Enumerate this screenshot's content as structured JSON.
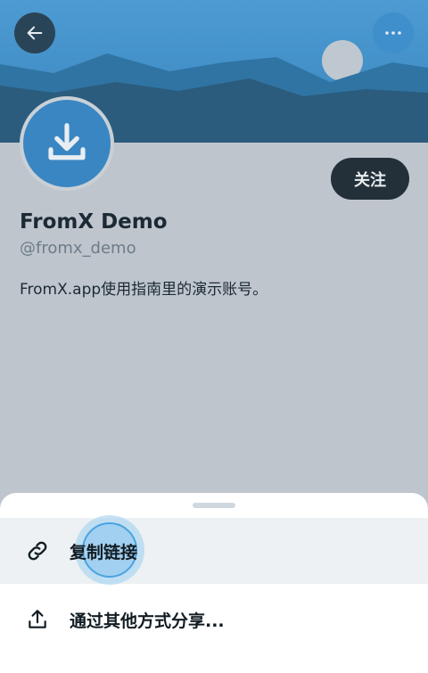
{
  "header": {
    "back_icon": "arrow-left-icon",
    "more_icon": "more-horizontal-icon",
    "banner_colors": {
      "sky": "#3f90c8",
      "mountain_far": "#2d6f99",
      "mountain_near": "#2d5979",
      "moon": "#bfc8d0"
    }
  },
  "profile": {
    "avatar_icon": "download-icon",
    "follow_label": "关注",
    "display_name": "FromX Demo",
    "handle": "@fromx_demo",
    "bio": "FromX.app使用指南里的演示账号。"
  },
  "share_sheet": {
    "items": [
      {
        "icon": "link-icon",
        "label": "复制链接"
      },
      {
        "icon": "share-icon",
        "label": "通过其他方式分享..."
      }
    ]
  },
  "colors": {
    "accent": "#3a86c3",
    "dark_button": "#233039",
    "overlay_background": "#bfc5cc"
  }
}
